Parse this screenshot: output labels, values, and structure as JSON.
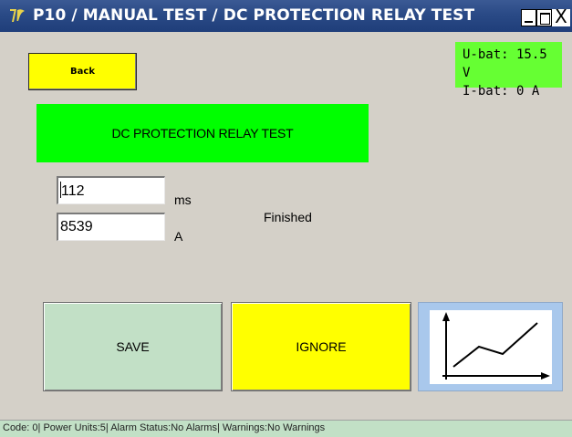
{
  "window": {
    "title": "P10 / MANUAL TEST / DC PROTECTION RELAY TEST",
    "icon": "app-logo-icon",
    "controls": {
      "minimize": "minimize-icon",
      "maximize": "maximize-icon",
      "close": "X"
    }
  },
  "battery": {
    "voltage": "U-bat: 15.5 V",
    "current": "I-bat: 0 A"
  },
  "back_label": "Back",
  "test_title": "DC PROTECTION RELAY TEST",
  "measurements": {
    "time_value": "112",
    "time_unit": "ms",
    "current_value": "8539",
    "current_unit": "A"
  },
  "status": "Finished",
  "actions": {
    "save_label": "SAVE",
    "ignore_label": "IGNORE",
    "graph_icon": "line-chart-icon"
  },
  "footer_text": "Code: 0| Power Units:5| Alarm Status:No Alarms| Warnings:No Warnings",
  "colors": {
    "titlebar": "#2a4a86",
    "status_box": "#66ff33",
    "accent_yellow": "#ffff00",
    "banner_green": "#00ff00",
    "save_green": "#c2e0c6",
    "graph_blue": "#a9c8ec",
    "background": "#d4d0c8"
  }
}
